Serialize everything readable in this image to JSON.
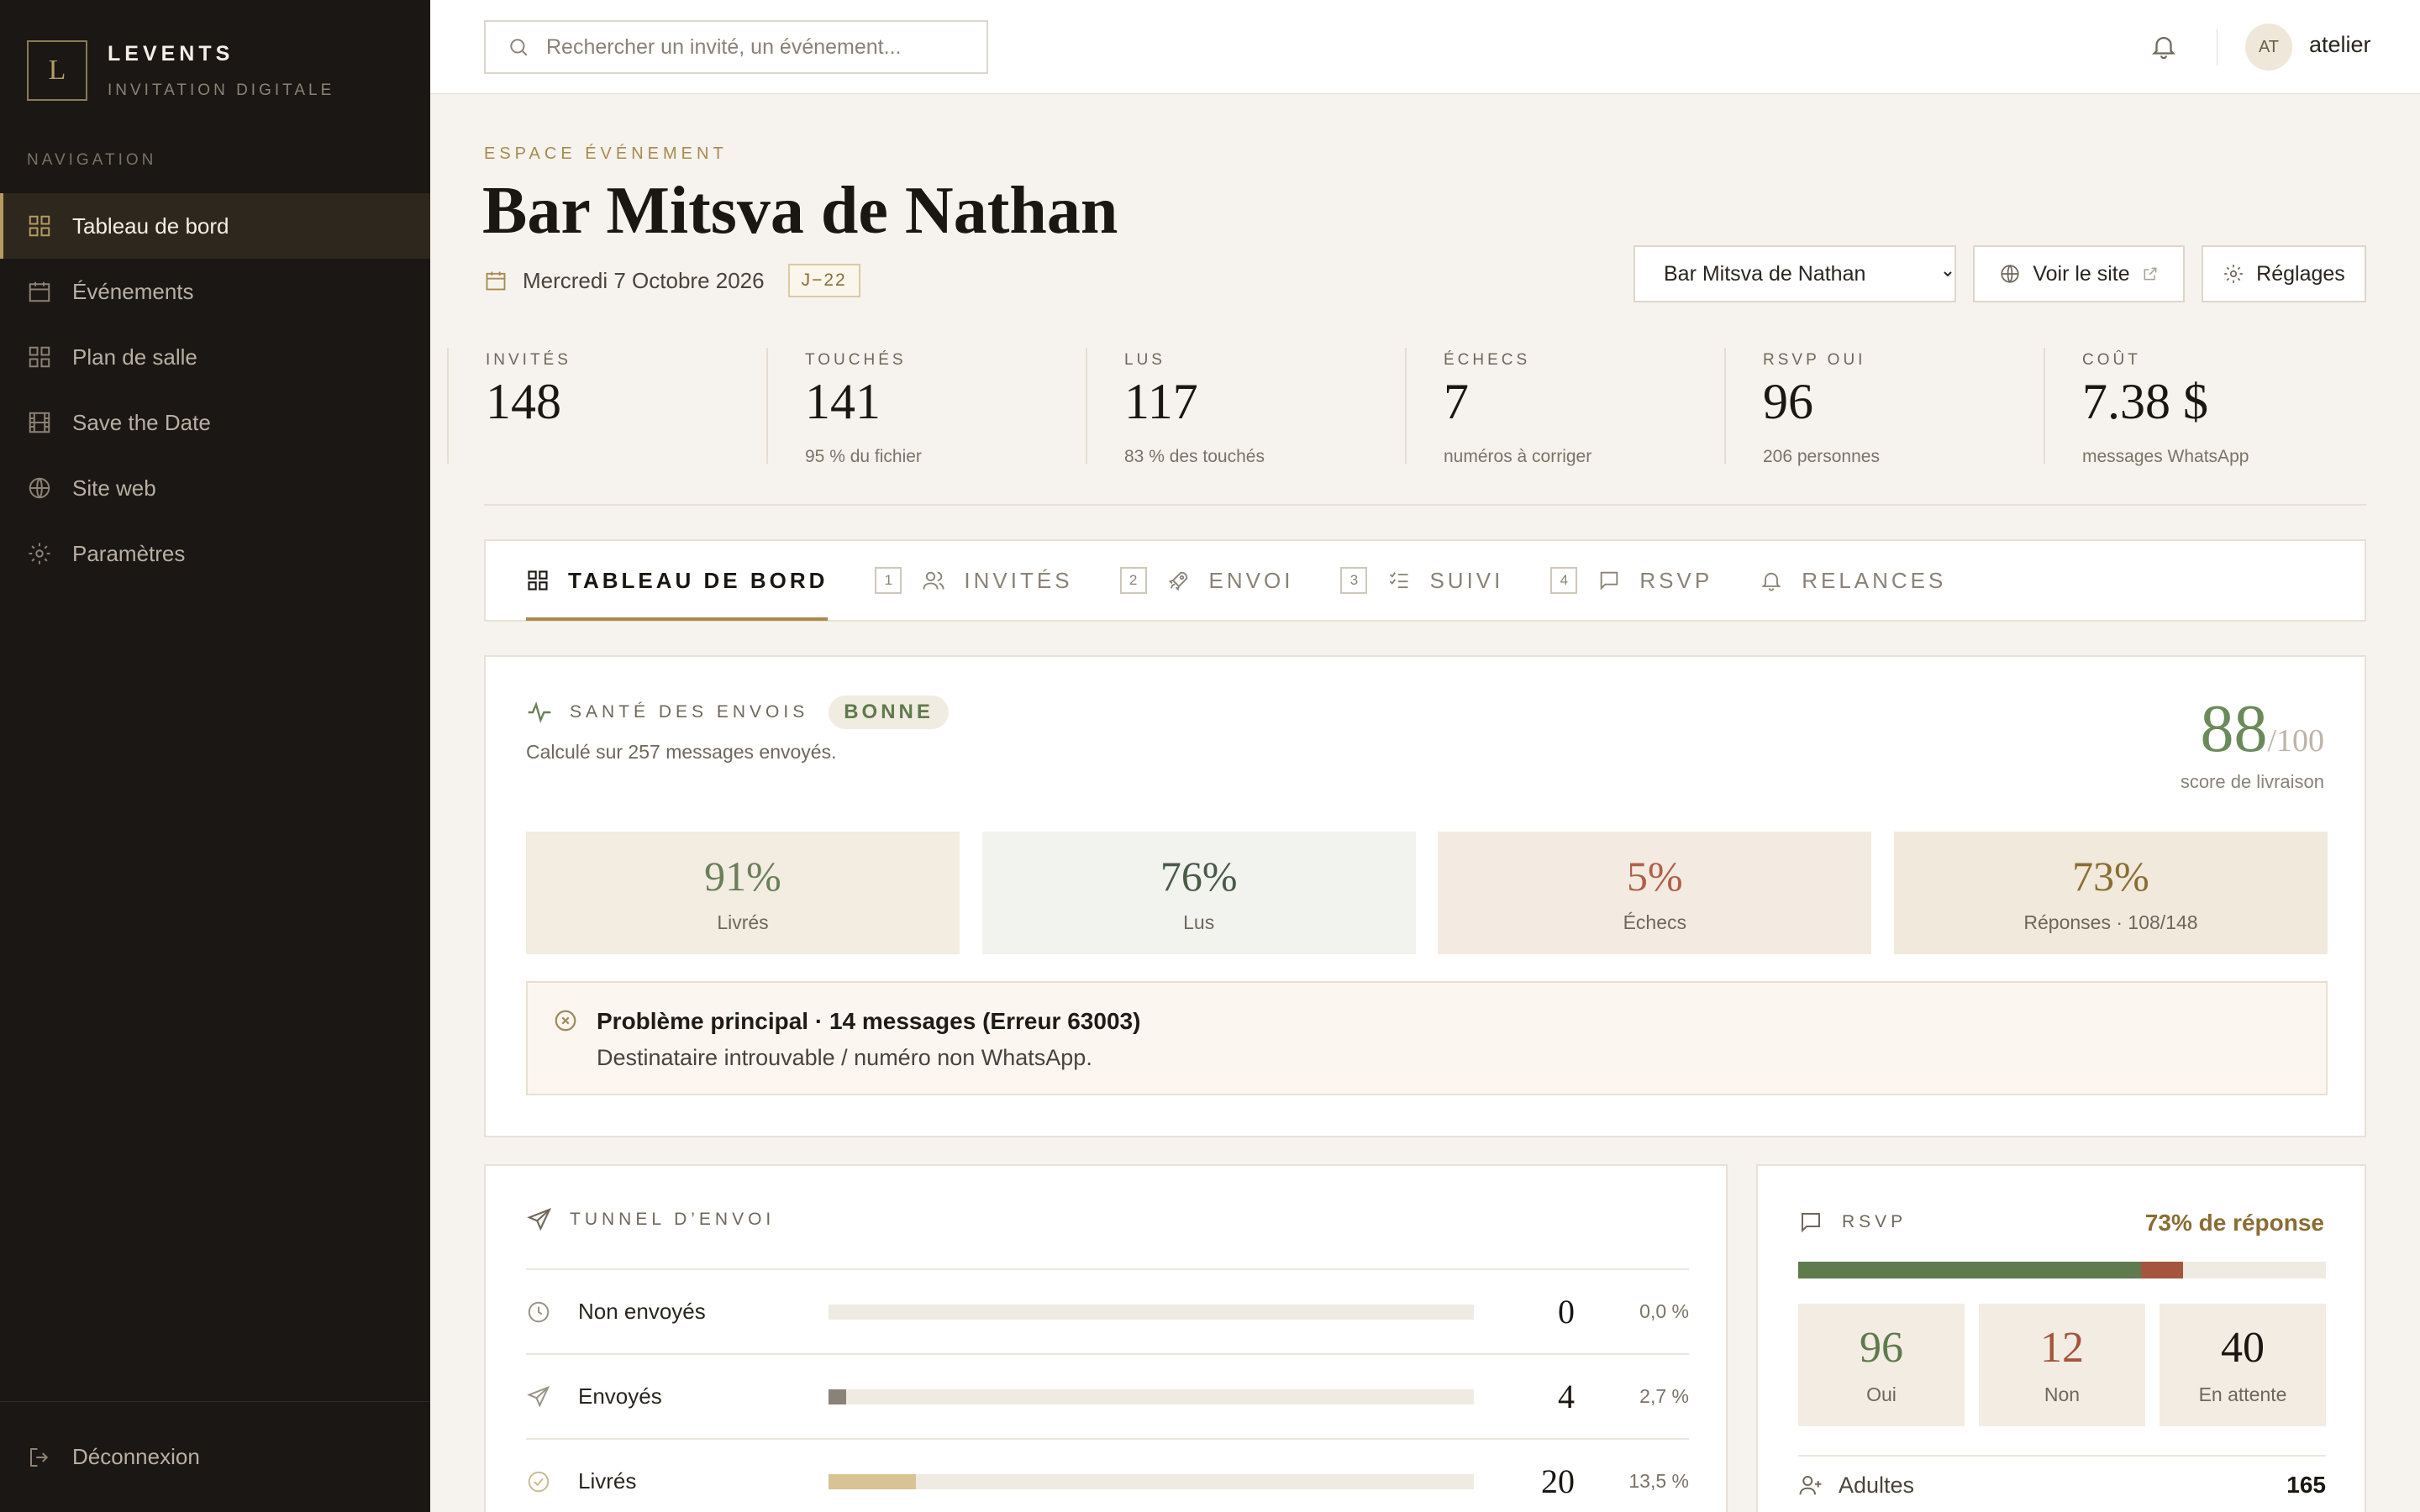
{
  "brand": {
    "mark": "L",
    "name": "LEVENTS",
    "subtitle": "INVITATION DIGITALE"
  },
  "nav": {
    "label": "NAVIGATION",
    "items": [
      {
        "label": "Tableau de bord",
        "icon": "grid-icon"
      },
      {
        "label": "Événements",
        "icon": "calendar-icon"
      },
      {
        "label": "Plan de salle",
        "icon": "layout-icon"
      },
      {
        "label": "Save the Date",
        "icon": "film-icon"
      },
      {
        "label": "Site web",
        "icon": "globe-icon"
      },
      {
        "label": "Paramètres",
        "icon": "gear-icon"
      }
    ],
    "logout": "Déconnexion"
  },
  "topbar": {
    "search_placeholder": "Rechercher un invité, un événement...",
    "avatar_initials": "AT",
    "username": "atelier"
  },
  "header": {
    "eyebrow": "ESPACE ÉVÉNEMENT",
    "title": "Bar Mitsva de Nathan",
    "date": "Mercredi 7 Octobre 2026",
    "countdown": "J−22",
    "event_select": "Bar Mitsva de Nathan",
    "view_site": "Voir le site",
    "settings": "Réglages"
  },
  "stats": [
    {
      "label": "INVITÉS",
      "value": "148",
      "sub": ""
    },
    {
      "label": "TOUCHÉS",
      "value": "141",
      "sub": "95 % du fichier"
    },
    {
      "label": "LUS",
      "value": "117",
      "sub": "83 % des touchés"
    },
    {
      "label": "ÉCHECS",
      "value": "7",
      "sub": "numéros à corriger"
    },
    {
      "label": "RSVP OUI",
      "value": "96",
      "sub": "206 personnes"
    },
    {
      "label": "COÛT",
      "value": "7.38 $",
      "sub": "messages WhatsApp"
    }
  ],
  "tabs": [
    {
      "label": "TABLEAU DE BORD",
      "num": "",
      "icon": "grid-icon"
    },
    {
      "label": "INVITÉS",
      "num": "1",
      "icon": "users-icon"
    },
    {
      "label": "ENVOI",
      "num": "2",
      "icon": "rocket-icon"
    },
    {
      "label": "SUIVI",
      "num": "3",
      "icon": "checklist-icon"
    },
    {
      "label": "RSVP",
      "num": "4",
      "icon": "message-icon"
    },
    {
      "label": "RELANCES",
      "num": "",
      "icon": "bell-icon"
    }
  ],
  "health": {
    "title": "SANTÉ DES ENVOIS",
    "status": "BONNE",
    "subtitle": "Calculé sur 257 messages envoyés.",
    "score": "88",
    "score_max": "/100",
    "score_label": "score de livraison",
    "metrics": [
      {
        "value": "91%",
        "label": "Livrés",
        "bg": "#f2ece1",
        "color": "#6b7f5a"
      },
      {
        "value": "76%",
        "label": "Lus",
        "bg": "#f2f3ef",
        "color": "#4a5a48"
      },
      {
        "value": "5%",
        "label": "Échecs",
        "bg": "#f3ebe1",
        "color": "#b0604a"
      },
      {
        "value": "73%",
        "label": "Réponses · 108/148",
        "bg": "#f1e9dc",
        "color": "#8a6d34"
      }
    ],
    "alert_title": "Problème principal · 14 messages (Erreur 63003)",
    "alert_desc": "Destinataire introuvable / numéro non WhatsApp."
  },
  "funnel": {
    "title": "TUNNEL D’ENVOI",
    "rows": [
      {
        "label": "Non envoyés",
        "count": "0",
        "pct": "0,0 %",
        "fraction": 0.0,
        "color": "#d9d2c6",
        "icon": "clock-icon"
      },
      {
        "label": "Envoyés",
        "count": "4",
        "pct": "2,7 %",
        "fraction": 0.027,
        "color": "#8a8276",
        "icon": "send-icon"
      },
      {
        "label": "Livrés",
        "count": "20",
        "pct": "13,5 %",
        "fraction": 0.135,
        "color": "#d7c394",
        "icon": "check-circle-icon"
      }
    ]
  },
  "rsvp": {
    "title": "RSVP",
    "rate": "73% de réponse",
    "bar": {
      "yes_fraction": 0.649,
      "no_fraction": 0.081,
      "yes_color": "#5f7a4d",
      "no_color": "#a5553d"
    },
    "boxes": [
      {
        "value": "96",
        "label": "Oui",
        "color": "#5f7a4d"
      },
      {
        "value": "12",
        "label": "Non",
        "color": "#a5553d"
      },
      {
        "value": "40",
        "label": "En attente",
        "color": "#1a1612"
      }
    ],
    "adults_label": "Adultes",
    "adults_value": "165"
  }
}
